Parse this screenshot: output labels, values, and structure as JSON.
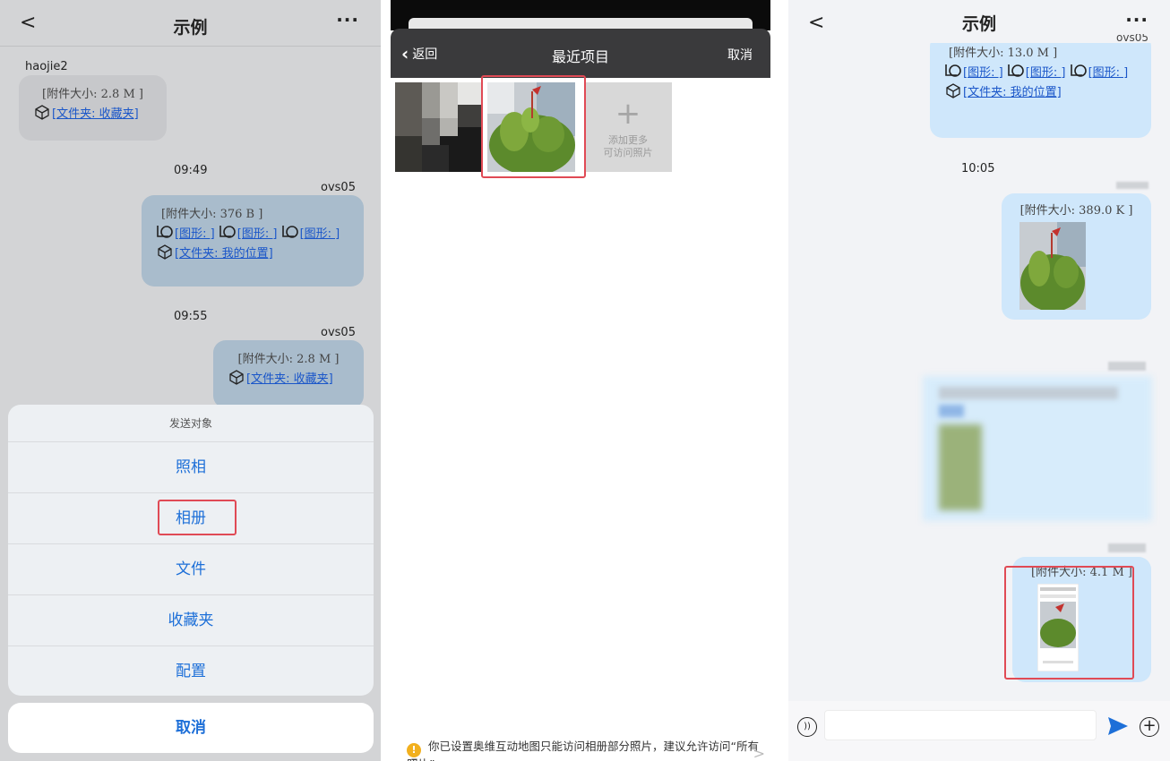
{
  "panel1": {
    "nav": {
      "back": "<",
      "title": "示例",
      "more": "···"
    },
    "messages": [
      {
        "sender": "haojie2",
        "size": "[附件大小: 2.8 M ]",
        "links": [
          "[文件夹: 收藏夹]"
        ]
      },
      {
        "time": "09:49",
        "sender": "ovs05",
        "size": "[附件大小: 376 B ]",
        "shapes": [
          "[图形: ]",
          "[图形: ]",
          "[图形: ]"
        ],
        "folder": "[文件夹: 我的位置]"
      },
      {
        "time": "09:55",
        "sender": "ovs05",
        "size": "[附件大小: 2.8 M ]",
        "folder": "[文件夹: 收藏夹]"
      }
    ],
    "sheet": {
      "title": "发送对象",
      "items": [
        "照相",
        "相册",
        "文件",
        "收藏夹",
        "配置"
      ],
      "cancel": "取消"
    }
  },
  "panel2": {
    "nav": {
      "back": "返回",
      "title": "最近项目",
      "cancel": "取消"
    },
    "add_more": {
      "plus": "+",
      "line1": "添加更多",
      "line2": "可访问照片"
    },
    "notice": {
      "icon": "!",
      "text": "你已设置奥维互动地图只能访问相册部分照片，建议允许访问“所有照片”",
      "arrow": ">"
    }
  },
  "panel3": {
    "nav": {
      "back": "<",
      "title": "示例",
      "more": "···",
      "peek": "ovs05"
    },
    "messages": [
      {
        "size": "[附件大小: 13.0 M ]",
        "shapes": [
          "[图形: ]",
          "[图形: ]",
          "[图形: ]"
        ],
        "folder": "[文件夹: 我的位置]"
      },
      {
        "time": "10:05",
        "size": "[附件大小: 389.0 K ]"
      },
      {
        "size": "[附件大小: 4.1 M ]"
      }
    ],
    "colors": {
      "accent": "#1d6fd8",
      "highlight": "#e04a55",
      "out_bubble": "#cfe7fb"
    }
  }
}
